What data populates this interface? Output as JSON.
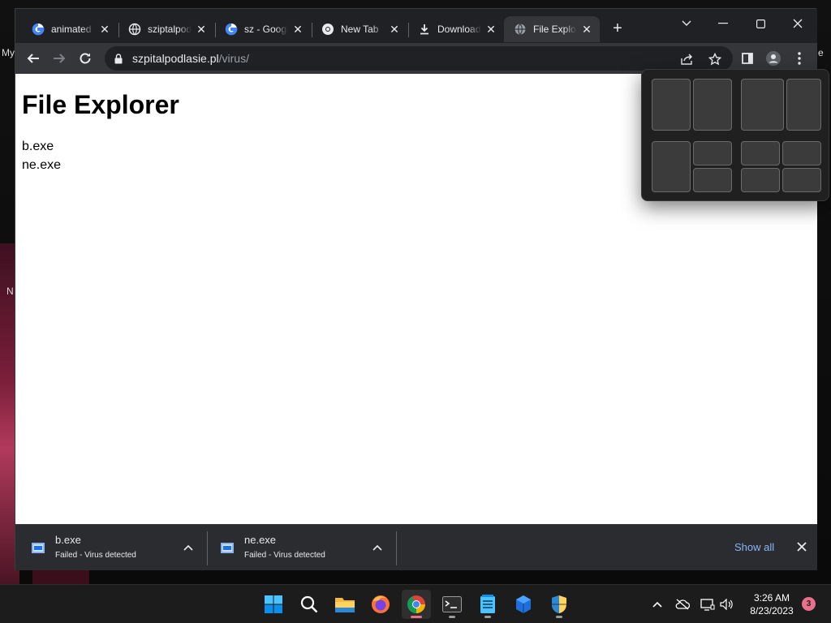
{
  "desktop": {
    "labels": [
      "My",
      "N",
      "e"
    ]
  },
  "browser": {
    "tabs": [
      {
        "title": "animated",
        "icon": "google-icon"
      },
      {
        "title": "sziptalpod",
        "icon": "globe-icon"
      },
      {
        "title": "sz - Google",
        "icon": "google-icon"
      },
      {
        "title": "New Tab",
        "icon": "chrome-icon"
      },
      {
        "title": "Download",
        "icon": "download-icon"
      },
      {
        "title": "File Explor",
        "icon": "globe-icon",
        "active": true
      }
    ],
    "address": {
      "host": "szpitalpodlasie.pl",
      "path": "/virus/"
    }
  },
  "page": {
    "title": "File Explorer",
    "files": [
      "b.exe",
      "ne.exe"
    ]
  },
  "downloads": {
    "items": [
      {
        "name": "b.exe",
        "status": "Failed - Virus detected"
      },
      {
        "name": "ne.exe",
        "status": "Failed - Virus detected"
      }
    ],
    "show_all": "Show all"
  },
  "taskbar": {
    "apps": [
      "start-icon",
      "search-icon",
      "file-explorer-icon",
      "firefox-icon",
      "chrome-icon",
      "terminal-icon",
      "notepad-icon",
      "app-cube-icon",
      "shield-icon"
    ],
    "clock": {
      "time": "3:26 AM",
      "date": "8/23/2023"
    },
    "notifications": "3"
  },
  "colors": {
    "accent": "#8ab4f8",
    "indicator": "#e8708a"
  }
}
